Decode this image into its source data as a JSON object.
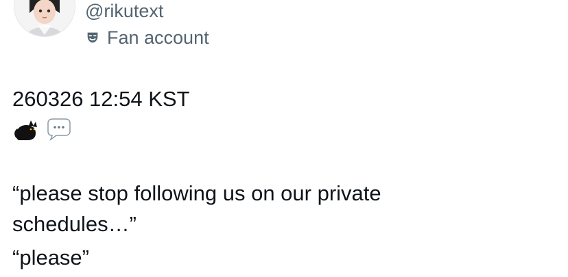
{
  "post": {
    "handle": "@rikutext",
    "affiliation_label": "Fan account",
    "timestamp_line": "260326 12:54 KST",
    "emojis": [
      "black-cat",
      "speech-bubble"
    ],
    "quote_line_1": "“please stop following us on our private",
    "quote_line_2": "schedules…”",
    "quote_line_3": "“please”"
  },
  "colors": {
    "text_primary": "#0f1419",
    "text_secondary": "#536471"
  }
}
